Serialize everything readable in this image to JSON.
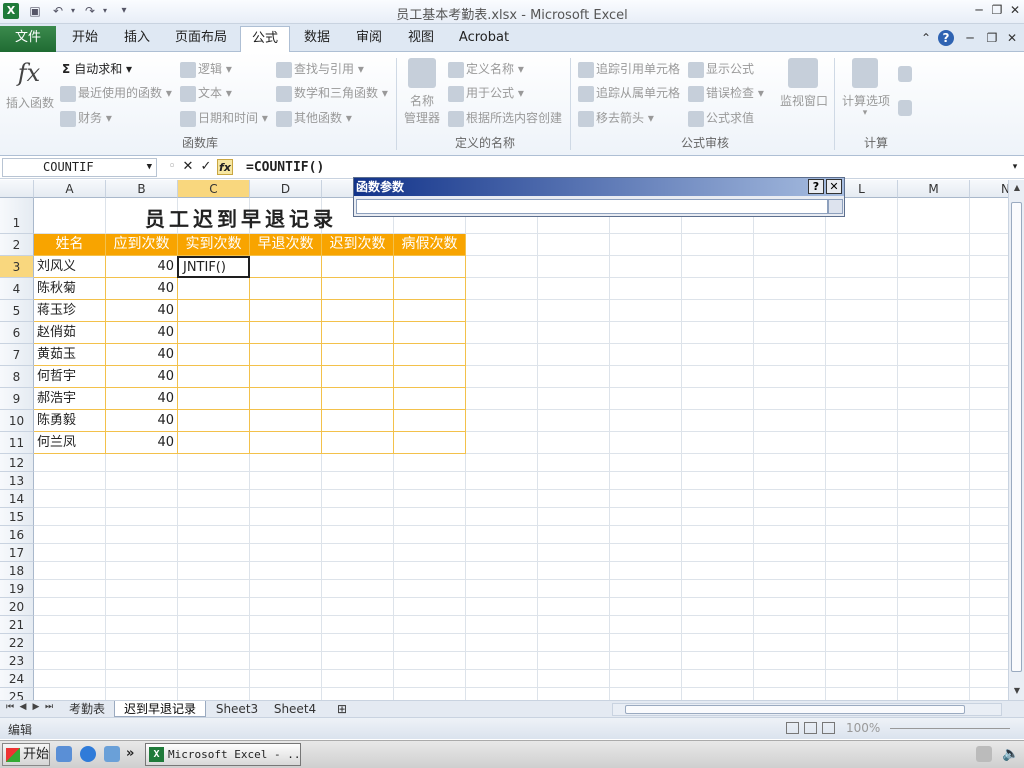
{
  "window": {
    "title": "员工基本考勤表.xlsx - Microsoft Excel",
    "app_icon": "X"
  },
  "tabs": {
    "file": "文件",
    "items": [
      "开始",
      "插入",
      "页面布局",
      "公式",
      "数据",
      "审阅",
      "视图",
      "Acrobat"
    ],
    "active": "公式"
  },
  "ribbon": {
    "insert_function": "插入函数",
    "groups": {
      "function_library": {
        "label": "函数库",
        "autosum": "自动求和",
        "recent": "最近使用的函数",
        "financial": "财务",
        "logical": "逻辑",
        "text": "文本",
        "datetime": "日期和时间",
        "lookup": "查找与引用",
        "math": "数学和三角函数",
        "more": "其他函数"
      },
      "defined_names": {
        "label": "定义的名称",
        "name_manager_1": "名称",
        "name_manager_2": "管理器",
        "define_name": "定义名称",
        "use_in_formula": "用于公式",
        "create_from_selection": "根据所选内容创建"
      },
      "formula_auditing": {
        "label": "公式审核",
        "trace_precedents": "追踪引用单元格",
        "trace_dependents": "追踪从属单元格",
        "remove_arrows": "移去箭头",
        "show_formulas": "显示公式",
        "error_checking": "错误检查",
        "evaluate_formula": "公式求值",
        "watch_window": "监视窗口"
      },
      "calculation": {
        "label": "计算",
        "options": "计算选项"
      }
    }
  },
  "formula_bar": {
    "name_box": "COUNTIF",
    "formula": "=COUNTIF()"
  },
  "dialog": {
    "title": "函数参数",
    "help": "?",
    "close": "✕"
  },
  "sheet": {
    "columns": [
      "A",
      "B",
      "C",
      "D",
      "E",
      "F",
      "G",
      "H",
      "I",
      "J",
      "K",
      "L",
      "M",
      "N"
    ],
    "selected_column": "C",
    "selected_row": "3",
    "rows": [
      "1",
      "2",
      "3",
      "4",
      "5",
      "6",
      "7",
      "8",
      "9",
      "10",
      "11",
      "12",
      "13",
      "14",
      "15",
      "16",
      "17",
      "18",
      "19",
      "20",
      "21",
      "22",
      "23",
      "24",
      "25"
    ],
    "title": "员工迟到早退记录",
    "headers": [
      "姓名",
      "应到次数",
      "实到次数",
      "早退次数",
      "迟到次数",
      "病假次数"
    ],
    "data": [
      {
        "name": "刘风义",
        "expected": "40"
      },
      {
        "name": "陈秋菊",
        "expected": "40"
      },
      {
        "name": "蒋玉珍",
        "expected": "40"
      },
      {
        "name": "赵俏茹",
        "expected": "40"
      },
      {
        "name": "黄茹玉",
        "expected": "40"
      },
      {
        "name": "何哲宇",
        "expected": "40"
      },
      {
        "name": "郝浩宇",
        "expected": "40"
      },
      {
        "name": "陈勇毅",
        "expected": "40"
      },
      {
        "name": "何兰凤",
        "expected": "40"
      }
    ],
    "active_cell_text": "JNTIF()"
  },
  "sheet_tabs": [
    "考勤表",
    "迟到早退记录",
    "Sheet3",
    "Sheet4"
  ],
  "active_sheet": "迟到早退记录",
  "status": {
    "mode": "编辑",
    "zoom": "100%"
  },
  "taskbar": {
    "start": "开始",
    "excel_task": "Microsoft Excel - ...",
    "chevron": "»"
  }
}
